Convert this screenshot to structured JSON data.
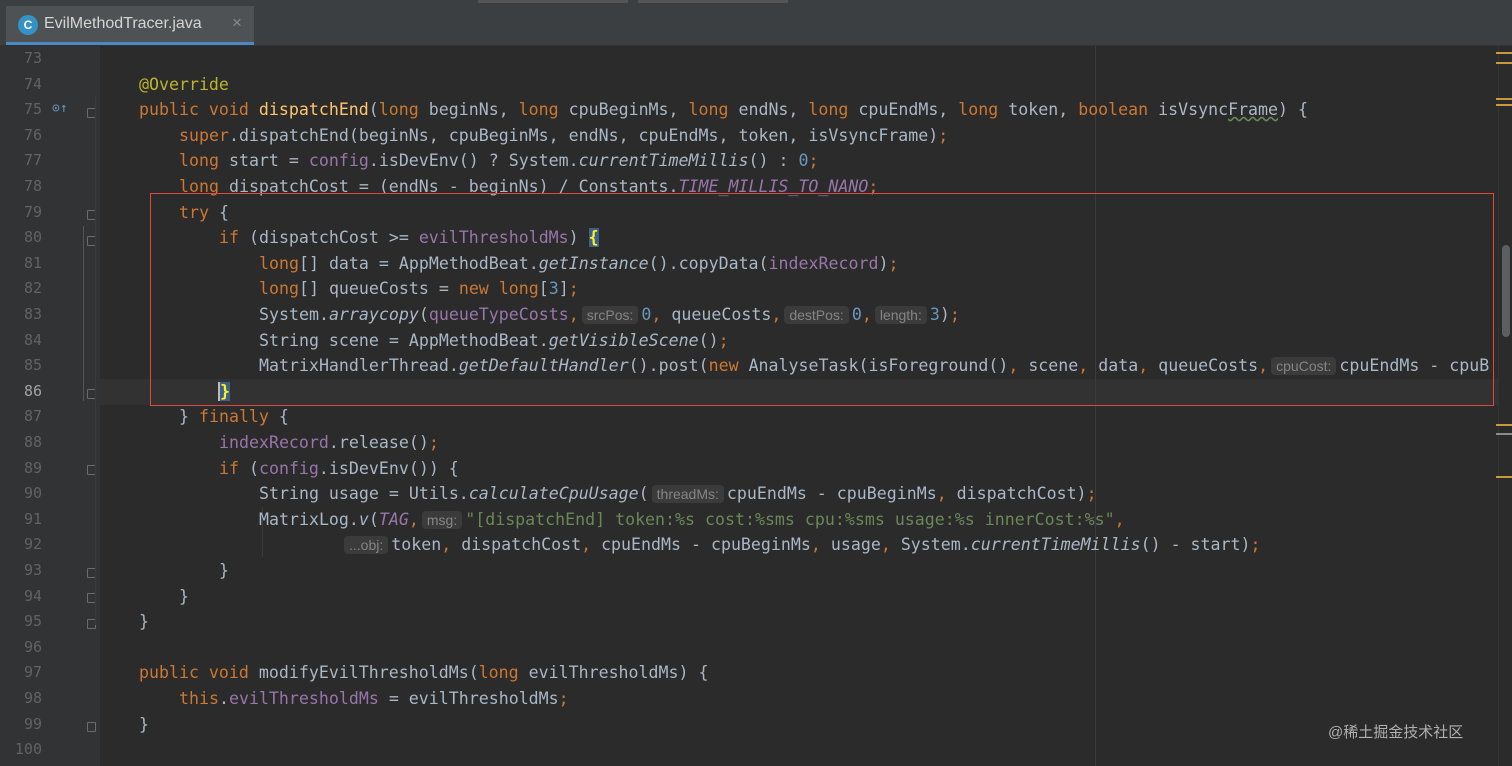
{
  "tab": {
    "icon": "C",
    "filename": "EvilMethodTracer.java",
    "close": "×"
  },
  "line_numbers": [
    "73",
    "74",
    "75",
    "76",
    "77",
    "78",
    "79",
    "80",
    "81",
    "82",
    "83",
    "84",
    "85",
    "86",
    "87",
    "88",
    "89",
    "90",
    "91",
    "92",
    "93",
    "94",
    "95",
    "96",
    "97",
    "98",
    "99",
    "100"
  ],
  "code": {
    "l74": {
      "annotation": "@Override"
    },
    "l75": {
      "public_void": "public void ",
      "name": "dispatchEnd",
      "p1": "(",
      "long1": "long",
      "a1": " beginNs, ",
      "long2": "long",
      "a2": " cpuBeginMs, ",
      "long3": "long",
      "a3": " endNs, ",
      "long4": "long",
      "a4": " cpuEndMs, ",
      "long5": "long",
      "a5": " token, ",
      "bool": "boolean",
      "a6a": " isVsync",
      "a6b": "Frame",
      "a6c": ") {"
    },
    "l76": {
      "kw": "super",
      "rest": ".dispatchEnd(beginNs, cpuBeginMs, endNs, cpuEndMs, token, isVsyncFrame)",
      "semi": ";"
    },
    "l77": {
      "kw": "long",
      "a": " start = ",
      "fld": "config",
      "b": ".isDevEnv() ? System.",
      "it": "currentTimeMillis",
      "c": "() : ",
      "num": "0",
      "semi": ";"
    },
    "l78": {
      "kw": "long",
      "a": " dispatchCost = (endNs - beginNs) / Constants.",
      "fld": "TIME_MILLIS_TO_NANO",
      "semi": ";"
    },
    "l79": {
      "kw": "try",
      "a": " {"
    },
    "l80": {
      "kw": "if",
      "a": " (dispatchCost >= ",
      "fld": "evilThresholdMs",
      "b": ") ",
      "brace": "{"
    },
    "l81": {
      "kw": "long",
      "a": "[] data = AppMethodBeat.",
      "it": "getInstance",
      "b": "().copyData(",
      "fld": "indexRecord",
      "c": ")",
      "semi": ";"
    },
    "l82": {
      "kw": "long",
      "a": "[] queueCosts = ",
      "kw2": "new",
      "sp": " ",
      "kw3": "long",
      "b": "[",
      "num": "3",
      "c": "]",
      "semi": ";"
    },
    "l83": {
      "a": "System.",
      "it": "arraycopy",
      "b": "(",
      "fld": "queueTypeCosts",
      "comma1": ",",
      "hint1": "srcPos:",
      "num1": "0",
      "comma2": ",",
      "c": " queueCosts",
      "comma3": ",",
      "hint2": "destPos:",
      "num2": "0",
      "comma4": ",",
      "hint3": "length:",
      "num3": "3",
      "d": ")",
      "semi": ";"
    },
    "l84": {
      "a": "String scene = AppMethodBeat.",
      "it": "getVisibleScene",
      "b": "()",
      "semi": ";"
    },
    "l85": {
      "a": "MatrixHandlerThread.",
      "it": "getDefaultHandler",
      "b": "().post(",
      "kw": "new",
      "c": " AnalyseTask(isForeground()",
      "comma1": ",",
      "d": " scene",
      "comma2": ",",
      "e": " data",
      "comma3": ",",
      "f": " queueCosts",
      "comma4": ",",
      "hint": "cpuCost:",
      "g": "cpuEndMs - cpuB"
    },
    "l86": {
      "brace": "}"
    },
    "l87": {
      "a": "} ",
      "kw": "finally",
      "b": " {"
    },
    "l88": {
      "fld": "indexRecord",
      "a": ".release()",
      "semi": ";"
    },
    "l89": {
      "kw": "if",
      "a": " (",
      "fld": "config",
      "b": ".isDevEnv()) {"
    },
    "l90": {
      "a": "String usage = Utils.",
      "it": "calculateCpuUsage",
      "b": "(",
      "hint": "threadMs:",
      "c": "cpuEndMs - cpuBeginMs",
      "comma": ",",
      "d": " dispatchCost)",
      "semi": ";"
    },
    "l91": {
      "a": "MatrixLog.",
      "it": "v",
      "b": "(",
      "fld": "TAG",
      "comma1": ",",
      "hint": "msg:",
      "str": "\"[dispatchEnd] token:%s cost:%sms cpu:%sms usage:%s innerCost:%s\"",
      "comma2": ","
    },
    "l92": {
      "hint": "...obj:",
      "a": "token",
      "comma1": ",",
      "b": " dispatchCost",
      "comma2": ",",
      "c": " cpuEndMs - cpuBeginMs",
      "comma3": ",",
      "d": " usage",
      "comma4": ",",
      "e": " System.",
      "it": "currentTimeMillis",
      "f": "() - start)",
      "semi": ";"
    },
    "l93": {
      "a": "}"
    },
    "l94": {
      "a": "}"
    },
    "l95": {
      "a": "}"
    },
    "l97": {
      "public_void": "public void ",
      "name": "modifyEvilThresholdMs",
      "a": "(",
      "kw": "long",
      "b": " evilThresholdMs) {"
    },
    "l98": {
      "kw": "this",
      "a": ".",
      "fld": "evilThresholdMs",
      "b": " = evilThresholdMs",
      "semi": ";"
    },
    "l99": {
      "a": "}"
    }
  },
  "watermark": "@稀土掘金技术社区",
  "colors": {
    "highlight_box": "#e0483f",
    "keyword": "#cc7832",
    "method": "#ffc66d",
    "field": "#9876aa",
    "number": "#6897bb",
    "string": "#6a8759"
  }
}
